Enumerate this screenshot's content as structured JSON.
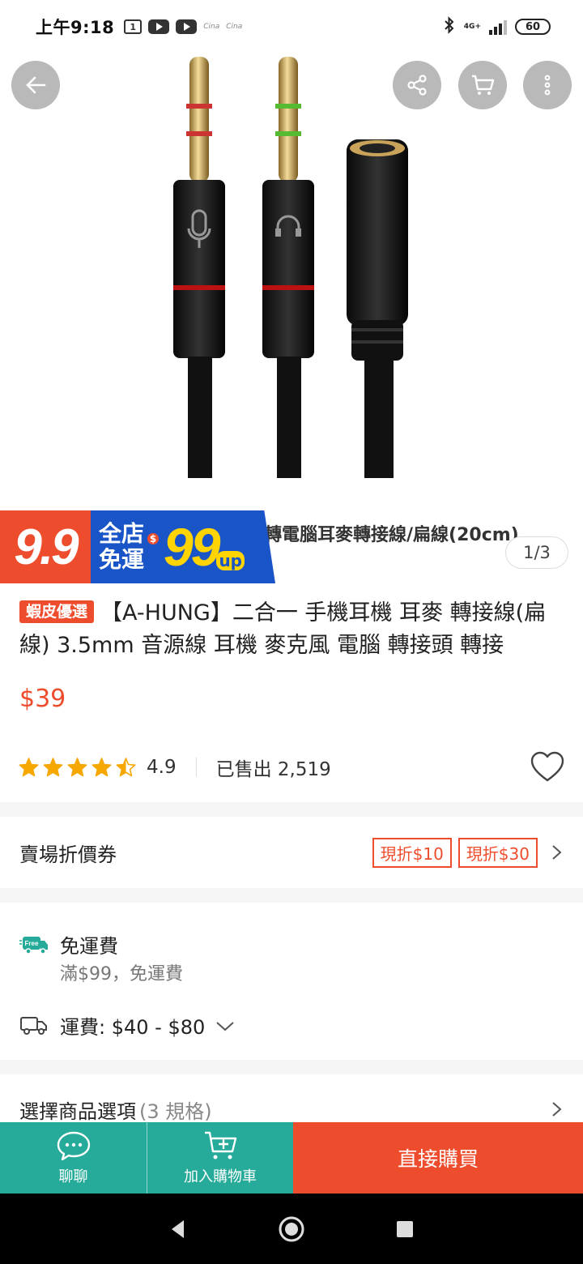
{
  "status_bar": {
    "time": "上午9:18",
    "notif_box": "1",
    "tiny_icon_1": "Cina",
    "tiny_icon_2": "Cina",
    "network": "4G+",
    "battery": "60"
  },
  "gallery": {
    "caption": "轉電腦耳麥轉接線/扁線(20cm)",
    "counter": "1/3",
    "promo": {
      "event": "9.9",
      "line1": "全店",
      "line2": "免運",
      "currency": "$",
      "amount": "99",
      "suffix": "up"
    }
  },
  "product": {
    "tag": "蝦皮優選",
    "title": "【A-HUNG】二合一 手機耳機 耳麥 轉接線(扁線) 3.5mm 音源線 耳機 麥克風 電腦 轉接頭 轉接",
    "price": "$39",
    "rating": "4.9",
    "rating_value": 4.5,
    "sold": "已售出 2,519"
  },
  "coupon_section": {
    "label": "賣場折價券",
    "coupons": [
      "現折$10",
      "現折$30"
    ]
  },
  "shipping": {
    "free_icon_text": "Free",
    "free_title": "免運費",
    "free_condition": "滿$99，免運費",
    "fee": "運費: $40 - $80"
  },
  "options": {
    "label": "選擇商品選項",
    "count": "(3 規格)"
  },
  "action_bar": {
    "chat_label": "聊聊",
    "cart_label": "加入購物車",
    "buy_label": "直接購買"
  },
  "colors": {
    "brand_orange": "#ee4d2d",
    "teal": "#26aa99",
    "promo_blue": "#1a55c8",
    "promo_yellow": "#ffd400"
  }
}
